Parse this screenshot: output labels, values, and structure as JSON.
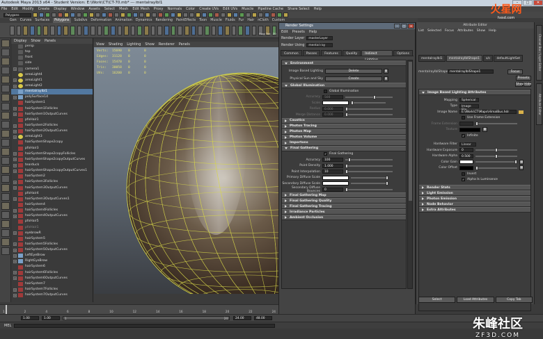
{
  "window": {
    "title": "Autodesk Maya 2013 x64 - Student Version: E:\\Work\\CT\\CT-70.mb* --- mentalrayIbl1"
  },
  "menubar": [
    "File",
    "Edit",
    "Modify",
    "Create",
    "Display",
    "Window",
    "Assets",
    "Select",
    "Mesh",
    "Edit Mesh",
    "Proxy",
    "Normals",
    "Color",
    "Create UVs",
    "Edit UVs",
    "Muscle",
    "Pipeline Cache",
    "Share Select",
    "Help"
  ],
  "modebar": {
    "mode": "Polygons"
  },
  "shelf_tabs": [
    "Gen",
    "Curves",
    "Surfaces",
    "Polygons",
    "Subdivs",
    "Deformation",
    "Animation",
    "Dynamics",
    "Rendering",
    "PaintEffects",
    "Toon",
    "Muscle",
    "Fluids",
    "Fur",
    "Hair",
    "nCloth",
    "Custom"
  ],
  "shelf_icons": [
    "",
    "",
    "",
    "",
    "",
    "",
    "",
    "",
    "",
    "",
    "",
    "",
    "",
    "",
    "",
    "",
    "",
    "",
    "",
    "",
    "",
    "",
    "",
    "",
    "",
    "",
    "",
    "",
    "",
    "",
    "",
    "",
    "",
    "",
    "",
    "",
    "",
    "Flood",
    "Tint",
    "ZO",
    "RO",
    "",
    "",
    "Jnt",
    "3S",
    "FF",
    "",
    "",
    "Imp",
    "CS",
    "Rs",
    "",
    "",
    "",
    "",
    "",
    "",
    "",
    "",
    "",
    ""
  ],
  "outliner": {
    "menu": [
      "Display",
      "Show",
      "Panels"
    ],
    "items": [
      {
        "label": "persp",
        "icon": "camera",
        "expand": false,
        "state": ""
      },
      {
        "label": "top",
        "icon": "camera",
        "expand": false,
        "state": ""
      },
      {
        "label": "front",
        "icon": "camera",
        "expand": false,
        "state": ""
      },
      {
        "label": "side",
        "icon": "camera",
        "expand": false,
        "state": ""
      },
      {
        "label": "camera1",
        "icon": "camera",
        "expand": true,
        "state": ""
      },
      {
        "label": "areaLight4",
        "icon": "light",
        "expand": false,
        "state": ""
      },
      {
        "label": "areaLight1",
        "icon": "light",
        "expand": true,
        "state": ""
      },
      {
        "label": "areaLight2",
        "icon": "light",
        "expand": true,
        "state": ""
      },
      {
        "label": "mentalrayIbl1",
        "icon": "mesh",
        "expand": false,
        "state": "sel"
      },
      {
        "label": "polySurface14",
        "icon": "mesh",
        "expand": true,
        "state": ""
      },
      {
        "label": "hairSystem1",
        "icon": "hair",
        "expand": false,
        "state": ""
      },
      {
        "label": "hairSystem1Follicles",
        "icon": "hair",
        "expand": true,
        "state": ""
      },
      {
        "label": "hairSystem1OutputCurves",
        "icon": "hair",
        "expand": true,
        "state": ""
      },
      {
        "label": "pfxHair1",
        "icon": "hair",
        "expand": false,
        "state": ""
      },
      {
        "label": "hairSystem2Follicles",
        "icon": "hair",
        "expand": true,
        "state": ""
      },
      {
        "label": "hairSystem2OutputCurves",
        "icon": "hair",
        "expand": true,
        "state": ""
      },
      {
        "label": "areaLight3",
        "icon": "light",
        "expand": true,
        "state": ""
      },
      {
        "label": "hairSystemShape2copy",
        "icon": "hair",
        "expand": false,
        "state": ""
      },
      {
        "label": "pfxHair3",
        "icon": "hair",
        "expand": false,
        "state": ""
      },
      {
        "label": "hairSystemShape2copyFollicles",
        "icon": "hair",
        "expand": true,
        "state": ""
      },
      {
        "label": "hairSystemShape2copyOutputCurves",
        "icon": "hair",
        "expand": true,
        "state": ""
      },
      {
        "label": "tearduck",
        "icon": "hair",
        "expand": true,
        "state": ""
      },
      {
        "label": "hairSystemShape2copyOutputCurves1",
        "icon": "hair",
        "expand": true,
        "state": ""
      },
      {
        "label": "hairSystem2",
        "icon": "hair",
        "expand": false,
        "state": ""
      },
      {
        "label": "hairSystem3Follicles",
        "icon": "hair",
        "expand": true,
        "state": ""
      },
      {
        "label": "hairSystem3OutputCurves",
        "icon": "hair",
        "expand": true,
        "state": ""
      },
      {
        "label": "pfxHair4",
        "icon": "hair",
        "expand": false,
        "state": ""
      },
      {
        "label": "hairSystem3OutputCurves1",
        "icon": "hair",
        "expand": true,
        "state": ""
      },
      {
        "label": "hairSystem4",
        "icon": "hair",
        "expand": false,
        "state": ""
      },
      {
        "label": "hairSystem4Follicles",
        "icon": "hair",
        "expand": true,
        "state": ""
      },
      {
        "label": "hairSystem4OutputCurves",
        "icon": "hair",
        "expand": true,
        "state": ""
      },
      {
        "label": "pfxHair5",
        "icon": "hair",
        "expand": false,
        "state": ""
      },
      {
        "label": "pfxHair1",
        "icon": "hair",
        "expand": false,
        "state": "dim"
      },
      {
        "label": "eyebrowR",
        "icon": "hair",
        "expand": true,
        "state": ""
      },
      {
        "label": "hairSystem5",
        "icon": "hair",
        "expand": false,
        "state": ""
      },
      {
        "label": "hairSystem5Follicles",
        "icon": "hair",
        "expand": true,
        "state": ""
      },
      {
        "label": "hairSystem5OutputCurves",
        "icon": "hair",
        "expand": true,
        "state": ""
      },
      {
        "label": "LeftEyeBrow",
        "icon": "mesh",
        "expand": true,
        "state": ""
      },
      {
        "label": "RightEyeBrow",
        "icon": "mesh",
        "expand": true,
        "state": ""
      },
      {
        "label": "hairSystem6",
        "icon": "hair",
        "expand": false,
        "state": ""
      },
      {
        "label": "hairSystem6Follicles",
        "icon": "hair",
        "expand": true,
        "state": ""
      },
      {
        "label": "hairSystem6OutputCurves",
        "icon": "hair",
        "expand": true,
        "state": ""
      },
      {
        "label": "hairSystem7",
        "icon": "hair",
        "expand": false,
        "state": ""
      },
      {
        "label": "hairSystem7Follicles",
        "icon": "hair",
        "expand": true,
        "state": ""
      },
      {
        "label": "hairSystem7OutputCurves",
        "icon": "hair",
        "expand": true,
        "state": ""
      }
    ]
  },
  "viewport": {
    "menu": [
      "View",
      "Shading",
      "Lighting",
      "Show",
      "Renderer",
      "Panels"
    ],
    "hud": [
      {
        "label": "Verts:",
        "a": "15690",
        "b": "0",
        "c": "0"
      },
      {
        "label": "Edges:",
        "a": "31128",
        "b": "0",
        "c": "0"
      },
      {
        "label": "Faces:",
        "a": "15470",
        "b": "0",
        "c": "0"
      },
      {
        "label": "Tris:",
        "a": "30058",
        "b": "0",
        "c": "0"
      },
      {
        "label": "UVs:",
        "a": "16200",
        "b": "0",
        "c": "0"
      }
    ]
  },
  "render_settings": {
    "title": "Render Settings",
    "menu": [
      "Edit",
      "Presets",
      "Help"
    ],
    "render_layer_label": "Render Layer",
    "render_layer_value": "masterLayer",
    "render_using_label": "Render Using",
    "render_using_value": "mental ray",
    "tabs": [
      "Common",
      "Passes",
      "Features",
      "Quality",
      "Indirect Lighting",
      "Options"
    ],
    "active_tab": "Indirect Lighting",
    "env_title": "Environment",
    "ibl_label": "Image Based Lighting",
    "ibl_button": "Delete",
    "sun_label": "Physical Sun and Sky",
    "sun_button": "Create",
    "gi_title": "Global Illumination",
    "gi_check": "Global Illumination",
    "gi_fields": [
      {
        "label": "Accuracy",
        "value": "500"
      },
      {
        "label": "Scale",
        "value": ""
      },
      {
        "label": "Radius",
        "value": "0.000"
      },
      {
        "label": "Merge Distance",
        "value": "0.000"
      }
    ],
    "collapsed_a": [
      "Caustics",
      "Photon Tracing",
      "Photon Map",
      "Photon Volume",
      "Importons"
    ],
    "fg_title": "Final Gathering",
    "fg_check": "Final Gathering",
    "fg_fields": [
      {
        "label": "Accuracy",
        "value": "100"
      },
      {
        "label": "Point Density",
        "value": "1.000"
      },
      {
        "label": "Point Interpolation",
        "value": "10"
      },
      {
        "label": "Primary Diffuse Scale",
        "value": ""
      },
      {
        "label": "Secondary Diffuse Scale",
        "value": ""
      },
      {
        "label": "Secondary Diffuse Bounces",
        "value": "0"
      }
    ],
    "collapsed_b": [
      "Final Gathering Map",
      "Final Gathering Quality",
      "Final Gathering Tracing",
      "Irradiance Particles",
      "Ambient Occlusion"
    ],
    "close": "Close"
  },
  "attribute_editor": {
    "title": "Attribute Editor",
    "menu": [
      "List",
      "Selected",
      "Focus",
      "Attributes",
      "Show",
      "Help"
    ],
    "node_tabs": [
      "mentalrayIbl1",
      "mentalrayIblShape1",
      "x/c",
      "defaultLightSet"
    ],
    "shape_label": "mentalrayIblShape:",
    "shape_value": "mentalrayIblShape1",
    "focus_btn": "Focus",
    "presets_btn": "Presets",
    "show_btn": "Show",
    "hide_btn": "Hide",
    "section_open": "Image Based Lighting Attributes",
    "mapping_label": "Mapping",
    "mapping_value": "Spherical",
    "type_label": "Type",
    "type_value": "Image File",
    "image_name_label": "Image Name",
    "image_name_value": "E:\\Work\\CT\\Maps\\HimalBus.hdr",
    "frame_ext_check": "Use Frame Extension",
    "frame_ext_label": "Frame Extension",
    "texture_label": "Texture",
    "infinite_check": "Infinite",
    "hw_filter_label": "Hardware Filter",
    "hw_filter_value": "Linear",
    "hw_exposure_label": "Hardware Exposure",
    "hw_exposure_value": "0",
    "hw_alpha_label": "Hardware Alpha",
    "hw_alpha_value": "0.500",
    "color_gain_label": "Color Gain",
    "color_offset_label": "Color Offset",
    "invert_check": "Invert",
    "alpha_lum_check": "Alpha Is Luminance",
    "collapsed": [
      "Render Stats",
      "Light Emission",
      "Photon Emission",
      "Node Behavior",
      "Extra Attributes"
    ],
    "select_btn": "Select",
    "load_btn": "Load Attributes",
    "copy_btn": "Copy Tab"
  },
  "side_tabs": [
    "Channel Box / Layer Editor",
    "Attribute Editor"
  ],
  "timeline": {
    "ticks": [
      "1",
      "2",
      "4",
      "6",
      "8",
      "10",
      "12",
      "14",
      "16",
      "18",
      "20",
      "22",
      "24"
    ]
  },
  "range": {
    "start": "1.00",
    "cur": "1.00",
    "in": "1",
    "out": "24",
    "end": "24.00",
    "end2": "48.00"
  },
  "cmd": {
    "label": "MEL"
  },
  "watermarks": {
    "top_cn": "火星网",
    "top_url": "hxsd.com",
    "bot_cn": "朱峰社区",
    "bot_url": "ZF3D.COM"
  },
  "colors": {
    "accent": "#5278a0",
    "wire": "#d6d64a"
  }
}
